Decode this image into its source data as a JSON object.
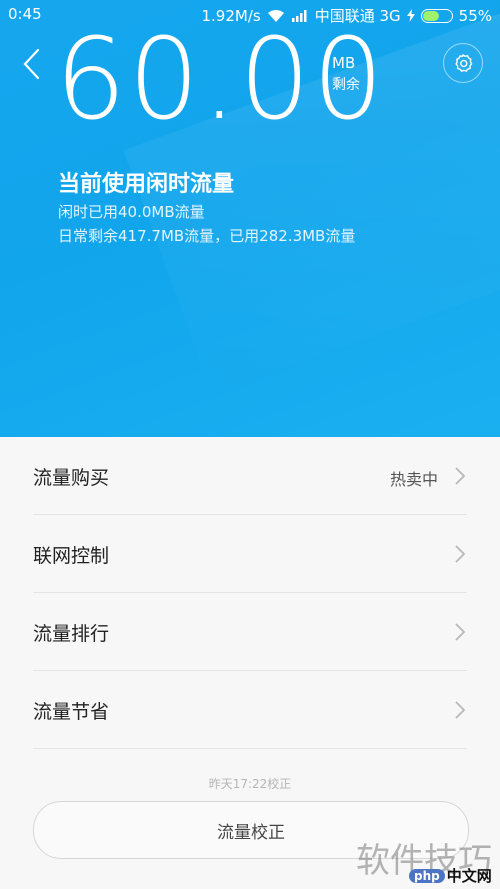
{
  "statusbar": {
    "time": "0:45",
    "speed": "1.92M/s",
    "carrier": "中国联通 3G",
    "battery": "55%",
    "battery_level": 0.55
  },
  "header": {
    "remaining_value": "60.00",
    "remaining_unit": "MB",
    "remaining_label": "剩余",
    "status_title": "当前使用闲时流量",
    "idle_used": "闲时已用40.0MB流量",
    "daily_summary": "日常剩余417.7MB流量，已用282.3MB流量"
  },
  "menu": [
    {
      "label": "流量购买",
      "value": "热卖中"
    },
    {
      "label": "联网控制",
      "value": ""
    },
    {
      "label": "流量排行",
      "value": ""
    },
    {
      "label": "流量节省",
      "value": ""
    }
  ],
  "footer": {
    "calibration_time": "昨天17:22校正",
    "calibrate_button": "流量校正"
  },
  "watermark": {
    "text": "软件技巧",
    "badge_php": "php",
    "badge_cn": "中文网"
  },
  "colors": {
    "header_bg": "#16a6ee",
    "page_bg": "#f7f7f7"
  }
}
